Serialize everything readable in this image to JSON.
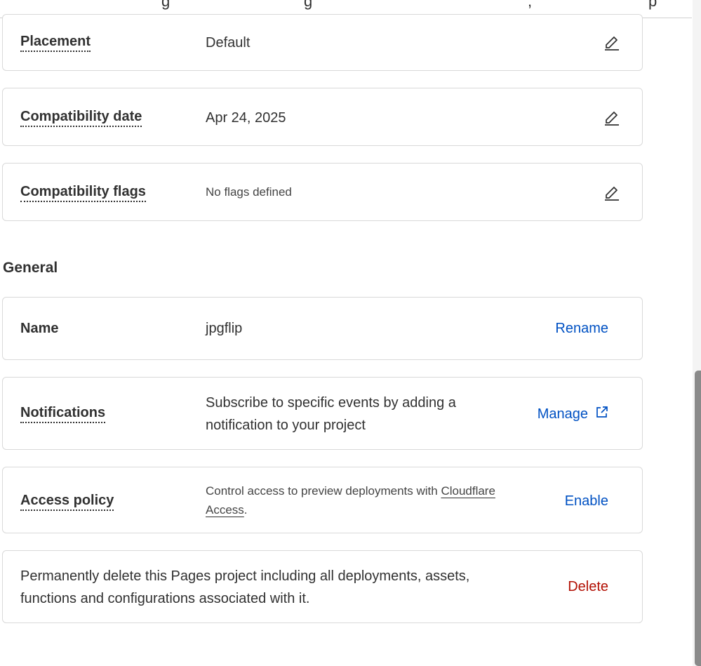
{
  "tabs": {
    "fragments": [
      "g",
      "g",
      ",",
      "p"
    ]
  },
  "runtime": {
    "placement": {
      "label": "Placement",
      "value": "Default"
    },
    "compat_date": {
      "label": "Compatibility date",
      "value": "Apr 24, 2025"
    },
    "compat_flags": {
      "label": "Compatibility flags",
      "value": "No flags defined"
    }
  },
  "general": {
    "title": "General",
    "name": {
      "label": "Name",
      "value": "jpgflip",
      "action": "Rename"
    },
    "notifications": {
      "label": "Notifications",
      "description": "Subscribe to specific events by adding a notification to your project",
      "action": "Manage"
    },
    "access_policy": {
      "label": "Access policy",
      "description_prefix": "Control access to preview deployments with ",
      "link_text": "Cloudflare Access",
      "description_suffix": ".",
      "action": "Enable"
    },
    "delete": {
      "description": "Permanently delete this Pages project including all deployments, assets, functions and configurations associated with it.",
      "action": "Delete"
    }
  },
  "colors": {
    "accent": "#0051c3",
    "danger": "#b20f03",
    "border": "#d9d9d9"
  }
}
